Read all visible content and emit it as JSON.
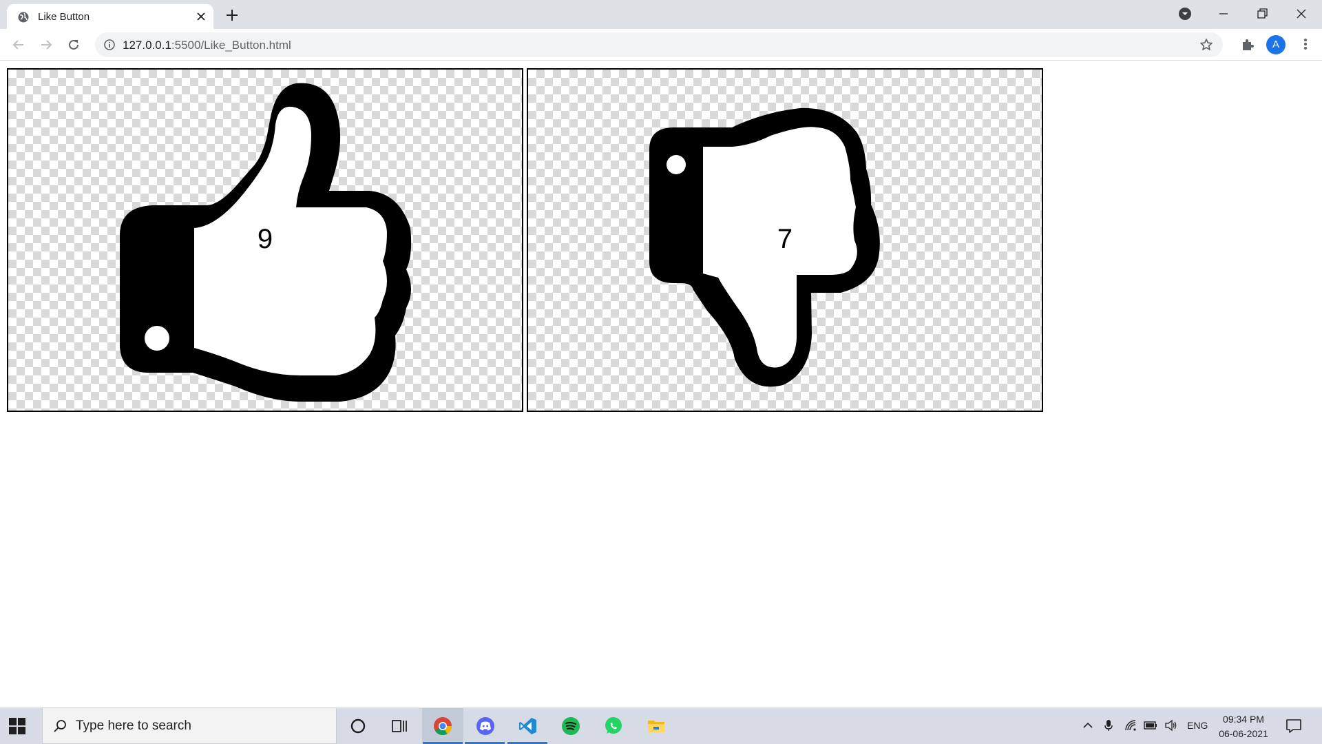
{
  "browser": {
    "tab": {
      "title": "Like Button",
      "favicon": "globe-icon"
    },
    "url": {
      "host": "127.0.0.1",
      "path": ":5500/Like_Button.html"
    },
    "profile_initial": "A"
  },
  "page": {
    "like": {
      "icon": "thumbs-up-icon",
      "count": "9"
    },
    "dislike": {
      "icon": "thumbs-down-icon",
      "count": "7"
    }
  },
  "taskbar": {
    "search_placeholder": "Type here to search",
    "apps": [
      "cortana-icon",
      "task-view-icon",
      "chrome-icon",
      "discord-icon",
      "vscode-icon",
      "spotify-icon",
      "whatsapp-icon",
      "file-explorer-icon"
    ],
    "tray": {
      "language": "ENG",
      "time": "09:34 PM",
      "date": "06-06-2021"
    }
  },
  "colors": {
    "accent": "#1a73e8",
    "chrome_bg": "#dee1e6",
    "taskbar_bg": "#d6dbe5"
  }
}
